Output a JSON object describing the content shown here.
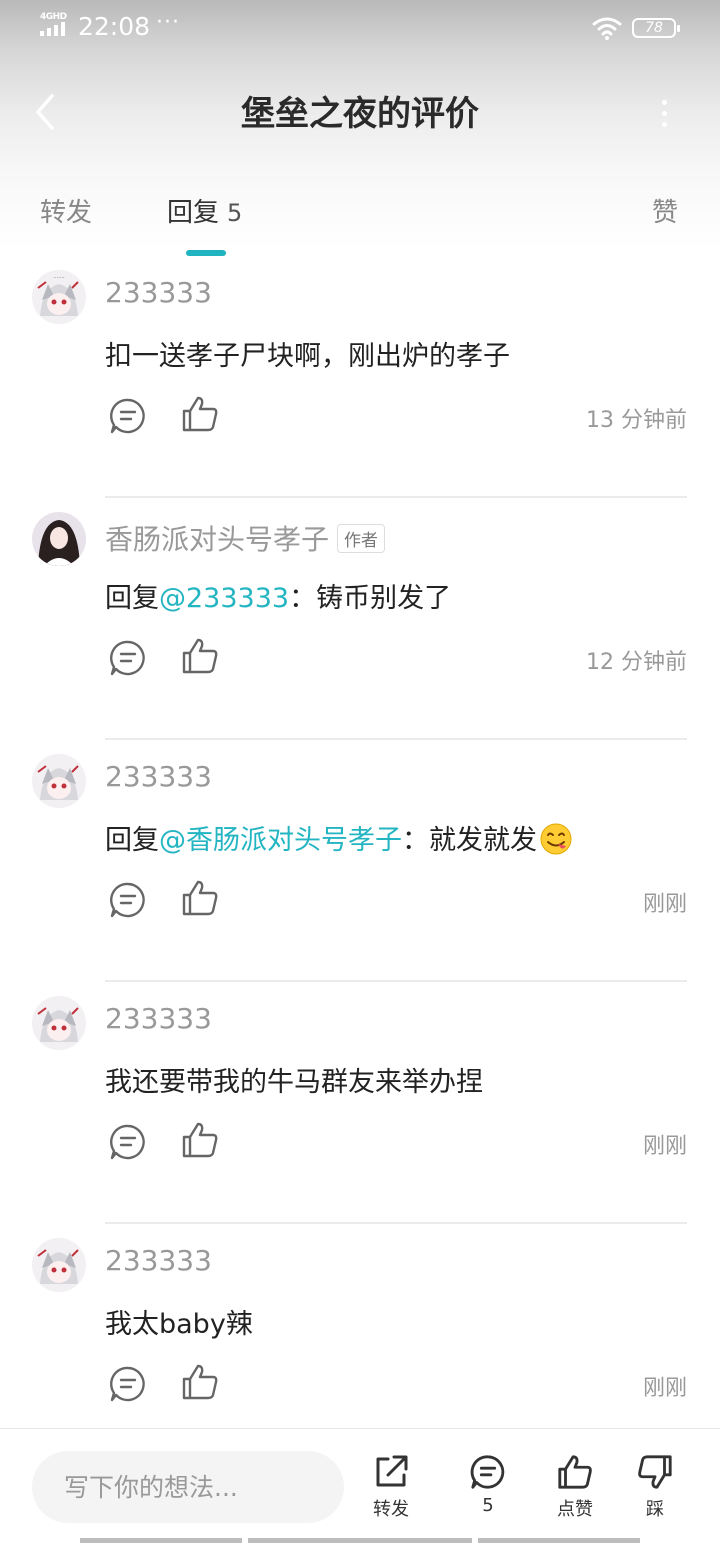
{
  "status_bar": {
    "network": "4GHD",
    "time": "22:08",
    "extra": "···",
    "battery": "78"
  },
  "header": {
    "title": "堡垒之夜的评价"
  },
  "tabs": [
    {
      "label": "转发"
    },
    {
      "label": "回复",
      "count": "5"
    },
    {
      "label": "赞"
    }
  ],
  "replies": [
    {
      "username": "233333",
      "content": "扣一送孝子尸块啊，刚出炉的孝子",
      "time": "13 分钟前"
    },
    {
      "username": "香肠派对头号孝子",
      "author_badge": "作者",
      "reply_prefix": "回复",
      "mention": "@233333",
      "content": "：铸币别发了",
      "time": "12 分钟前"
    },
    {
      "username": "233333",
      "reply_prefix": "回复",
      "mention": "@香肠派对头号孝子",
      "content": "：就发就发",
      "emoji": "yum-face-emoji",
      "time": "刚刚"
    },
    {
      "username": "233333",
      "content": "我还要带我的牛马群友来举办捏",
      "time": "刚刚"
    },
    {
      "username": "233333",
      "content": "我太baby辣",
      "time": "刚刚"
    }
  ],
  "bottom_bar": {
    "input_placeholder": "写下你的想法...",
    "share_label": "转发",
    "comment_count": "5",
    "like_label": "点赞",
    "dislike_label": "踩"
  },
  "colors": {
    "accent": "#20b4c0",
    "mention": "#24b5c2"
  }
}
